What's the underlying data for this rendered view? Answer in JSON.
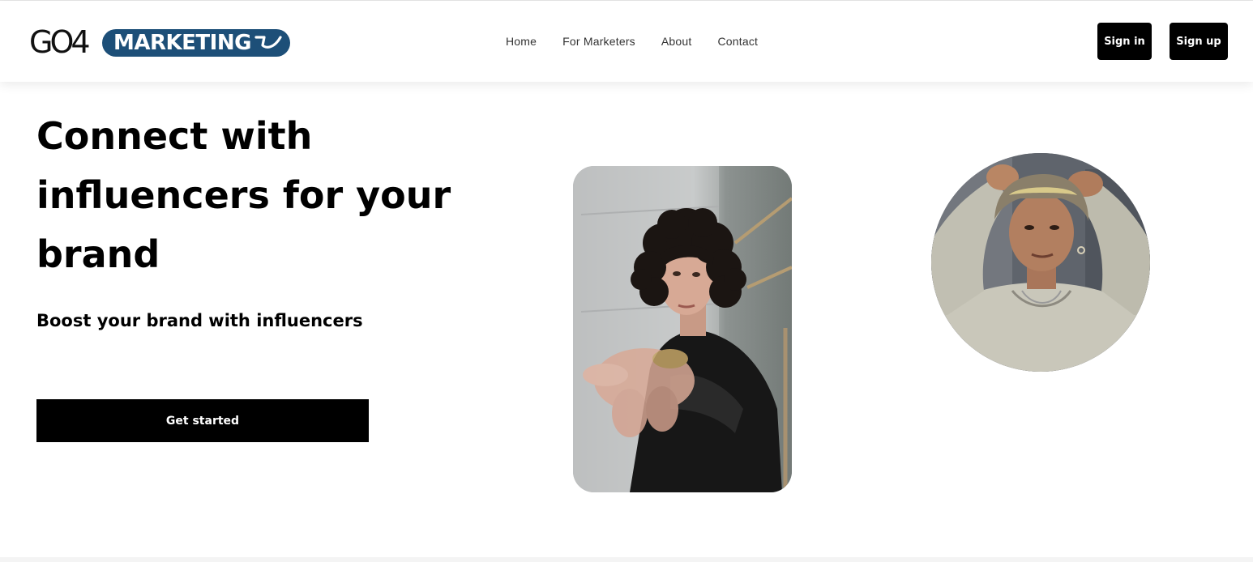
{
  "brand": {
    "logo_left": "GO4",
    "logo_right": "MARKETING"
  },
  "nav": {
    "items": [
      {
        "label": "Home"
      },
      {
        "label": "For Marketers"
      },
      {
        "label": "About"
      },
      {
        "label": "Contact"
      }
    ]
  },
  "auth": {
    "sign_in": "Sign in",
    "sign_up": "Sign up"
  },
  "hero": {
    "headline_lines": [
      "Connect with",
      "influencers for your",
      "brand"
    ],
    "subheadline": "Boost your brand with influencers",
    "cta": "Get started"
  },
  "colors": {
    "brand_blue": "#1d4f78",
    "button_black": "#000000",
    "text": "#000000"
  },
  "images": {
    "woman_photo": "woman-with-curly-hair-reaching-toward-camera",
    "man_photo": "man-with-bucket-hat-hands-on-head"
  }
}
